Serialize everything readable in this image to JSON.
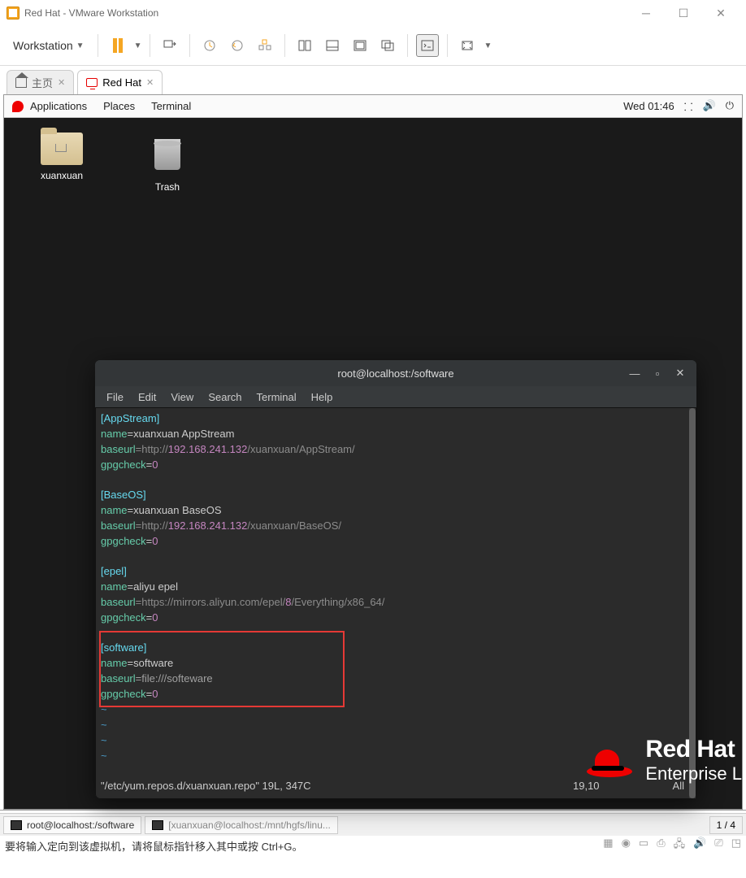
{
  "title": "Red Hat - VMware Workstation",
  "menu": "Workstation",
  "tabs": {
    "home": "主页",
    "active": "Red Hat"
  },
  "panel": {
    "apps": "Applications",
    "places": "Places",
    "terminal": "Terminal",
    "clock": "Wed 01:46"
  },
  "desktop": {
    "folder": "xuanxuan",
    "trash": "Trash"
  },
  "term": {
    "title": "root@localhost:/software",
    "menu": [
      "File",
      "Edit",
      "View",
      "Search",
      "Terminal",
      "Help"
    ],
    "sections": {
      "appstream": {
        "head": "[AppStream]",
        "name_k": "name",
        "name_v": "=xuanxuan AppStream",
        "url_k": "baseurl",
        "proto": "=http://",
        "ip": "192.168.241.132",
        "path": "/xuanxuan/AppStream/",
        "gpg_k": "gpgcheck",
        "gpg_v": "=",
        "gpg_n": "0"
      },
      "baseos": {
        "head": "[BaseOS]",
        "name_k": "name",
        "name_v": "=xuanxuan BaseOS",
        "url_k": "baseurl",
        "proto": "=http://",
        "ip": "192.168.241.132",
        "path": "/xuanxuan/BaseOS/",
        "gpg_k": "gpgcheck",
        "gpg_v": "=",
        "gpg_n": "0"
      },
      "epel": {
        "head": "[epel]",
        "name_k": "name",
        "name_v": "=aliyu epel",
        "url_k": "baseurl",
        "proto_full": "=https://mirrors.aliyun.com/epel/",
        "eight": "8",
        "rest": "/Everything/x86_64/",
        "gpg_k": "gpgcheck",
        "gpg_v": "=",
        "gpg_n": "0"
      },
      "software": {
        "head": "[software]",
        "name_k": "name",
        "name_v": "=software",
        "url_k": "baseurl",
        "url_v": "=file:///softeware",
        "gpg_k": "gpgcheck",
        "gpg_v": "=",
        "gpg_n": "0"
      }
    },
    "tilde": "~",
    "status_file": "\"/etc/yum.repos.d/xuanxuan.repo\" 19L, 347C",
    "status_pos": "19,10",
    "status_all": "All"
  },
  "rh": {
    "l1": "Red Hat",
    "l2": "Enterprise L"
  },
  "footer": {
    "item1": "root@localhost:/software",
    "item2": "[xuanxuan@localhost:/mnt/hgfs/linu...",
    "counter": "1 / 4"
  },
  "hint": "要将输入定向到该虚拟机，请将鼠标指针移入其中或按 Ctrl+G。"
}
